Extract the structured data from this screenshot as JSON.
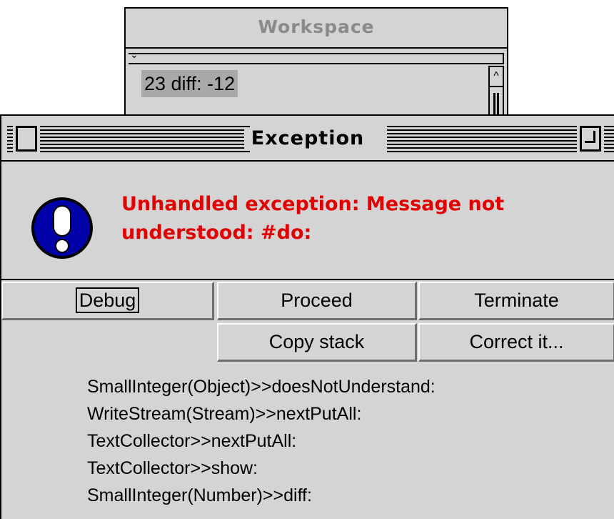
{
  "workspace": {
    "title": "Workspace",
    "menu_glyph": "⌄",
    "selected_text": "23 diff: -12",
    "scroll_up_glyph": "^"
  },
  "exception": {
    "title": "Exception",
    "icon": "exclamation-icon",
    "message": "Unhandled exception: Message not understood: #do:",
    "buttons": {
      "debug": "Debug",
      "proceed": "Proceed",
      "terminate": "Terminate",
      "copy_stack": "Copy stack",
      "correct_it": "Correct it..."
    },
    "stack": [
      "SmallInteger(Object)>>doesNotUnderstand:",
      "WriteStream(Stream)>>nextPutAll:",
      "TextCollector>>nextPutAll:",
      "TextCollector>>show:",
      "SmallInteger(Number)>>diff:"
    ],
    "colors": {
      "message": "#e00000",
      "icon_fill": "#0000a8"
    }
  }
}
